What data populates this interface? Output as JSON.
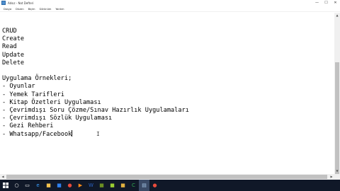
{
  "window": {
    "title": "Adsız - Not Defteri",
    "controls": {
      "minimize": "—",
      "maximize": "☐",
      "close": "✕"
    }
  },
  "menu": {
    "items": [
      "Dosya",
      "Düzen",
      "Biçim",
      "Görünüm",
      "Yardım"
    ]
  },
  "editor": {
    "lines": [
      "CRUD",
      "Create",
      "Read",
      "Update",
      "Delete",
      "",
      "Uygulama Örnekleri;",
      "- Oyunlar",
      "- Yemek Tarifleri",
      "- Kitap Özetleri Uygulaması",
      "- Çevrimdışı Soru Çözme/Sınav Hazırlık Uygulamaları",
      "- Çevrimdışı Sözlük Uygulaması",
      "- Gezi Rehberi",
      "- Whatsapp/Facebook"
    ],
    "cursor_glyph": "I"
  },
  "scrollbars": {
    "up_arrow": "▲",
    "down_arrow": "▼",
    "left_arrow": "◀",
    "right_arrow": "▶"
  },
  "taskbar": {
    "icons": [
      {
        "name": "search-icon",
        "glyph": "○",
        "color": "#ffffff"
      },
      {
        "name": "task-view-icon",
        "glyph": "▭",
        "color": "#ffffff"
      },
      {
        "name": "edge-icon",
        "glyph": "e",
        "color": "#3aa0ff"
      },
      {
        "name": "file-explorer-icon",
        "glyph": "■",
        "color": "#f2c14e"
      },
      {
        "name": "store-icon",
        "glyph": "■",
        "color": "#2f80ed"
      },
      {
        "name": "chrome-icon",
        "glyph": "●",
        "color": "#e94b3c"
      },
      {
        "name": "media-player-icon",
        "glyph": "▶",
        "color": "#ff8c1a"
      },
      {
        "name": "word-icon",
        "glyph": "W",
        "color": "#2b63c4"
      },
      {
        "name": "terminal-icon",
        "glyph": "■",
        "color": "#6b8e23"
      },
      {
        "name": "image-viewer-icon",
        "glyph": "■",
        "color": "#9acd32"
      },
      {
        "name": "folder-icon",
        "glyph": "■",
        "color": "#e0b040"
      },
      {
        "name": "camtasia-icon",
        "glyph": "C",
        "color": "#2fa84f"
      },
      {
        "name": "notepad-icon",
        "glyph": "▤",
        "color": "#a8c8e8"
      },
      {
        "name": "chrome-2-icon",
        "glyph": "●",
        "color": "#e94b3c"
      }
    ]
  }
}
